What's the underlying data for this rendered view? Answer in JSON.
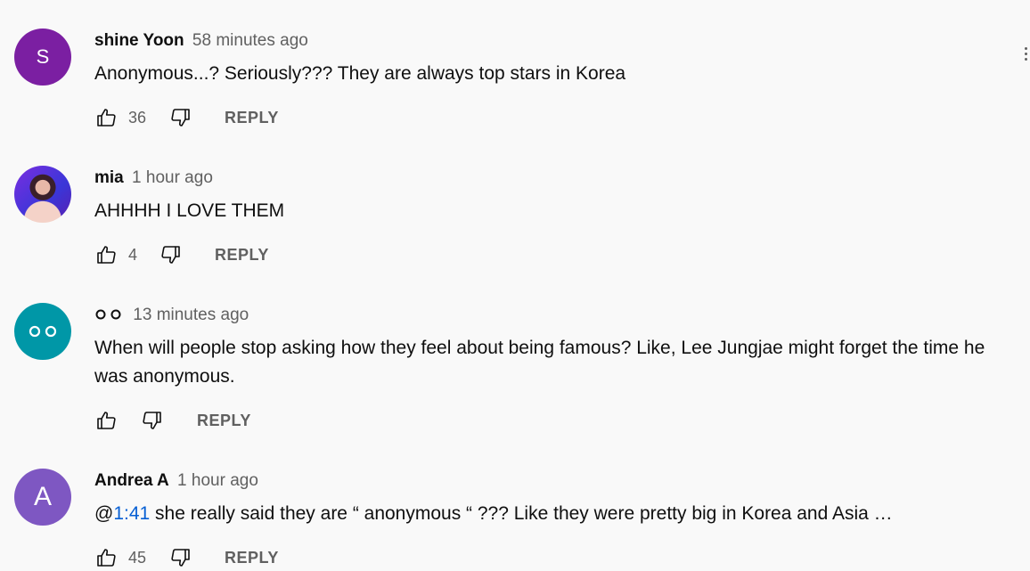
{
  "comments": [
    {
      "avatar_letter": "S",
      "avatar_color": "#7b1fa2",
      "author": "shine Yoon",
      "time": "58 minutes ago",
      "text": "Anonymous...? Seriously??? They are always top stars in Korea",
      "likes": "36",
      "reply_label": "REPLY"
    },
    {
      "avatar_letter": "",
      "author": "mia",
      "time": "1 hour ago",
      "text": "AHHHH I LOVE THEM",
      "likes": "4",
      "reply_label": "REPLY"
    },
    {
      "avatar_letter": "○○",
      "avatar_color": "#0097a7",
      "author": "○○",
      "time": "13 minutes ago",
      "text": "When will people stop asking how they feel about being famous? Like, Lee Jungjae might forget the time he was anonymous.",
      "likes": "",
      "reply_label": "REPLY"
    },
    {
      "avatar_letter": "A",
      "avatar_color": "#7e57c2",
      "author": "Andrea A",
      "time": "1 hour ago",
      "text_prefix": "@",
      "timestamp_link": "1:41",
      "text": " she really said they are “ anonymous “ ??? Like they were pretty big in Korea and Asia …",
      "likes": "45",
      "reply_label": "REPLY"
    }
  ],
  "icons": {
    "like": "thumb-up-icon",
    "dislike": "thumb-down-icon",
    "menu": "more-vert-icon"
  }
}
